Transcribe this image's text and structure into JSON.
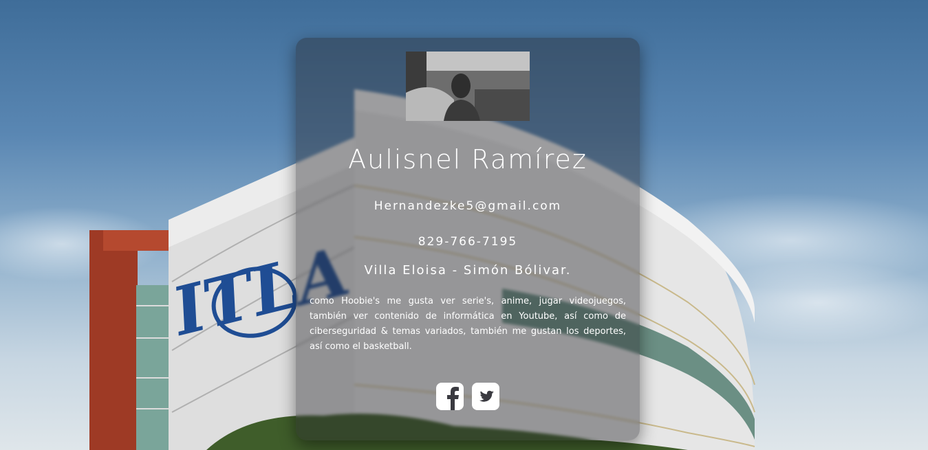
{
  "profile": {
    "name": "Aulisnel Ramírez",
    "email": "Hernandezke5@gmail.com",
    "phone": "829-766-7195",
    "address": "Villa Eloisa - Simón Bólivar.",
    "bio": "como Hoobie's me gusta ver serie's, anime, jugar videojuegos, también ver contenido de informática en Youtube, así como de ciberseguridad & temas variados, también me gustan los deportes, así como el basketball."
  },
  "background": {
    "sign_text": "ITLA",
    "sky_color": "#4a78a5",
    "building_color": "#e8e8e8",
    "sign_color": "#1f4d94"
  },
  "socials": [
    {
      "icon": "facebook-icon"
    },
    {
      "icon": "twitter-icon"
    }
  ]
}
